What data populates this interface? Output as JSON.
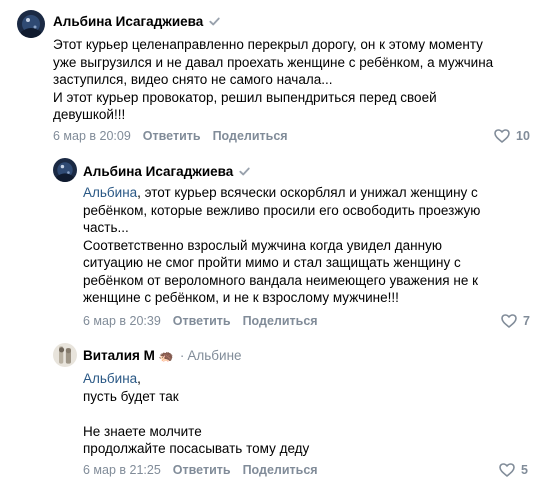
{
  "comments": [
    {
      "author": "Альбина Исагаджиева",
      "verified": true,
      "text_lines": [
        "Этот курьер целенаправленно перекрыл дорогу, он к этому моменту",
        "уже выгрузился и не давал проехать женщине с ребёнком, а мужчина",
        "заступился, видео снято не самого начала...",
        "И этот курьер провокатор, решил выпендриться перед своей",
        "девушкой!!!"
      ],
      "date": "6 мар в 20:09",
      "reply_label": "Ответить",
      "share_label": "Поделиться",
      "likes": "10"
    },
    {
      "author": "Альбина Исагаджиева",
      "verified": true,
      "mention": "Альбина",
      "text_lines": [
        ", этот курьер всячески оскорблял и унижал женщину с",
        "ребёнком, которые вежливо просили его освободить проезжую",
        "часть...",
        "Соответственно взрослый мужчина когда увидел данную",
        "ситуацию не смог пройти мимо и стал защищать женщину с",
        "ребёнком от вероломного вандала неимеющего уважения не к",
        "женщине с ребёнком, и не к взрослому мужчине!!!"
      ],
      "date": "6 мар в 20:39",
      "reply_label": "Ответить",
      "share_label": "Поделиться",
      "likes": "7"
    },
    {
      "author": "Виталия М",
      "emoji_badge": "🦔",
      "reply_to": "Альбине",
      "mention": "Альбина",
      "text_lines": [
        ",",
        "пусть будет так",
        "",
        "Не знаете молчите",
        "продолжайте посасывать тому деду"
      ],
      "date": "6 мар в 21:25",
      "reply_label": "Ответить",
      "share_label": "Поделиться",
      "likes": "5"
    }
  ],
  "colors": {
    "link": "#2a5885",
    "secondary": "#818c99",
    "verified": "#99a2ad"
  }
}
